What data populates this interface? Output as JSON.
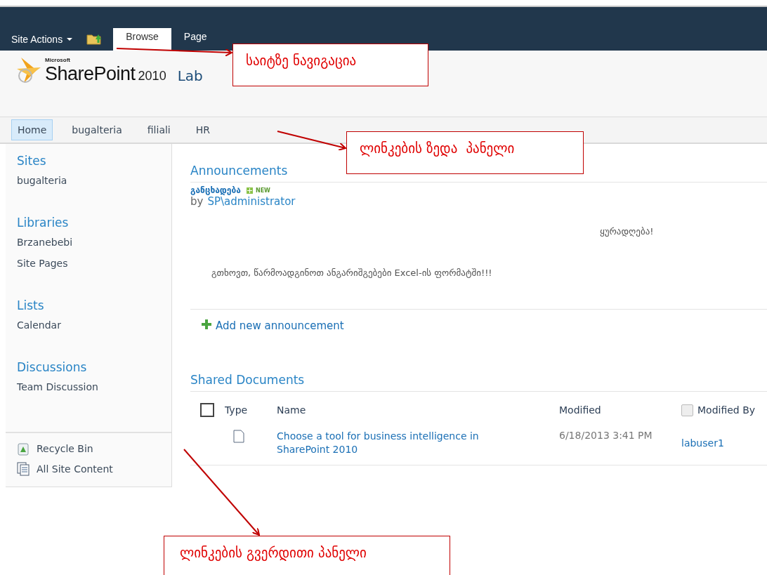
{
  "ribbon": {
    "site_actions": "Site Actions",
    "tabs": [
      {
        "label": "Browse",
        "selected": true
      },
      {
        "label": "Page",
        "selected": false
      }
    ]
  },
  "header": {
    "microsoft": "Microsoft",
    "product": "SharePoint",
    "version": "2010",
    "site_title": "Lab"
  },
  "top_nav": [
    {
      "label": "Home",
      "selected": true
    },
    {
      "label": "bugalteria",
      "selected": false
    },
    {
      "label": "filiali",
      "selected": false
    },
    {
      "label": "HR",
      "selected": false
    }
  ],
  "sidebar": {
    "sections": [
      {
        "heading": "Sites",
        "items": [
          "bugalteria"
        ]
      },
      {
        "heading": "Libraries",
        "items": [
          "Brzanebebi",
          "Site Pages"
        ]
      },
      {
        "heading": "Lists",
        "items": [
          "Calendar"
        ]
      },
      {
        "heading": "Discussions",
        "items": [
          "Team Discussion"
        ]
      }
    ],
    "footer_links": [
      {
        "label": "Recycle Bin",
        "kind": "recycle"
      },
      {
        "label": "All Site Content",
        "kind": "content"
      }
    ]
  },
  "announcements": {
    "title": "Announcements",
    "item": {
      "title": "განცხადება",
      "badge": "NEW",
      "by": "by",
      "author": "SP\\administrator",
      "body": [
        "ყურადღება!",
        "გთხოვთ, წარმოადგინოთ ანგარიშგებები Excel-ის ფორმატში!!!"
      ]
    },
    "add_link": "Add new announcement"
  },
  "documents": {
    "title": "Shared Documents",
    "select_all": {
      "checked": false
    },
    "columns": [
      "Type",
      "Name",
      "Modified",
      "Modified By"
    ],
    "rows": [
      {
        "name": "Choose a tool for business intelligence in SharePoint 2010",
        "modified": "6/18/2013 3:41 PM",
        "modified_by": "labuser1"
      }
    ]
  },
  "callouts": [
    {
      "text": "საიტზე ნავიგაცია"
    },
    {
      "text": "ლინკების ზედა  პანელი"
    },
    {
      "text": "ლინკების გვერდითი პანელი"
    }
  ]
}
